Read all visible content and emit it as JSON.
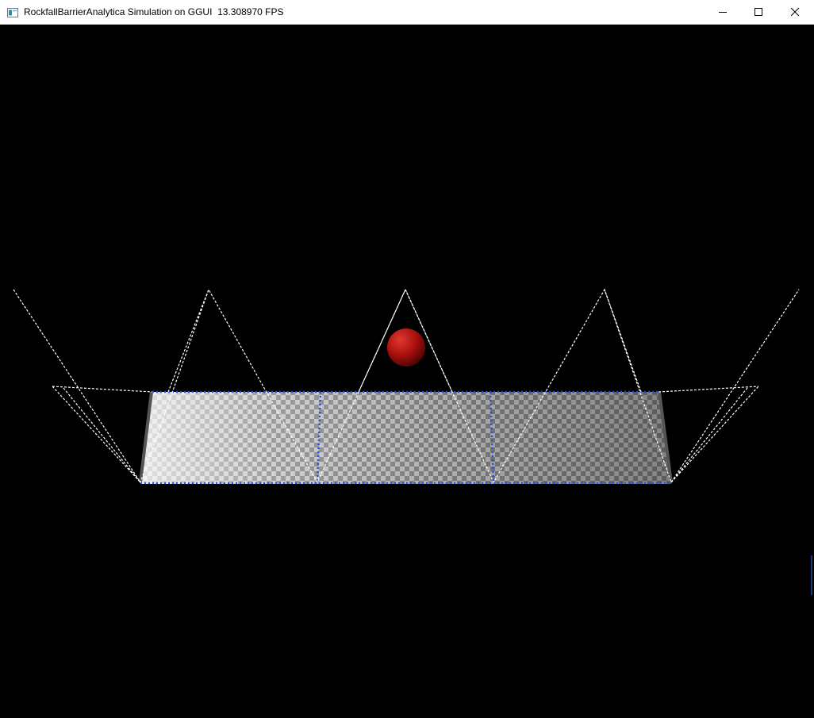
{
  "window": {
    "title": "RockfallBarrierAnalytica Simulation on GGUI  13.308970 FPS",
    "app_icon": "window-app-icon",
    "controls": {
      "minimize_icon": "minimize-icon",
      "maximize_icon": "maximize-icon",
      "close_icon": "close-icon"
    }
  },
  "scene": {
    "background_color": "#000000",
    "rock_color": "#c0100f",
    "net_color": "#cfcfcf",
    "net_edge_color": "#2a4ad8",
    "cable_color": "#ffffff",
    "post_color": "#5a5a5a"
  }
}
